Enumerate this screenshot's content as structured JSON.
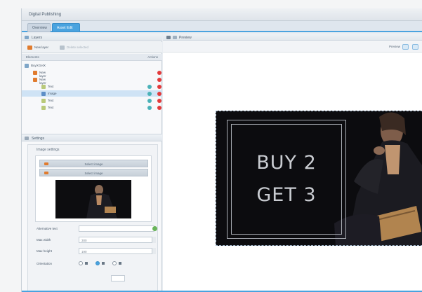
{
  "app": {
    "title": "Digital Publishing"
  },
  "tabs": [
    {
      "label": "Overview",
      "active": false
    },
    {
      "label": "Asset Edit",
      "active": true
    }
  ],
  "left": {
    "layers_panel": {
      "title": "Layers",
      "toolbar": {
        "new_layer": "New layer",
        "delete_layer": "Delete selected"
      },
      "columns": {
        "elements": "Elements",
        "actions": "Actions"
      },
      "tree": [
        {
          "label": "BuyXGetX",
          "depth": 0,
          "type": "root",
          "selected": false,
          "visibility": false,
          "delete": false
        },
        {
          "label": "New layer",
          "depth": 1,
          "type": "layer",
          "selected": false,
          "visibility": false,
          "delete": true
        },
        {
          "label": "New layer",
          "depth": 1,
          "type": "layer",
          "selected": false,
          "visibility": false,
          "delete": true
        },
        {
          "label": "Text",
          "depth": 2,
          "type": "text",
          "selected": false,
          "visibility": true,
          "delete": true
        },
        {
          "label": "Image",
          "depth": 2,
          "type": "image",
          "selected": true,
          "visibility": true,
          "delete": true
        },
        {
          "label": "Text",
          "depth": 2,
          "type": "text",
          "selected": false,
          "visibility": true,
          "delete": true
        },
        {
          "label": "Text",
          "depth": 2,
          "type": "text",
          "selected": false,
          "visibility": true,
          "delete": true
        }
      ]
    },
    "settings_panel": {
      "title": "Settings",
      "group_title": "Image settings",
      "buttons": {
        "select_image": "Select image",
        "clear_image": "Select image"
      },
      "fields": {
        "alt_text": {
          "label": "Alternative text",
          "value": ""
        },
        "max_width": {
          "label": "Max width",
          "value": "300"
        },
        "max_height": {
          "label": "Max height",
          "value": "190"
        },
        "orientation": {
          "label": "Orientation",
          "selected": 1
        }
      }
    }
  },
  "right": {
    "preview_panel": {
      "title": "Preview",
      "toolbar_label": "Preview"
    },
    "canvas": {
      "line1": "BUY 2",
      "line2": "GET 3"
    }
  },
  "colors": {
    "accent": "#4aa3df",
    "delete": "#e33a3a",
    "visible": "#4ab2b8",
    "layer_icon": "#e07b2e"
  }
}
